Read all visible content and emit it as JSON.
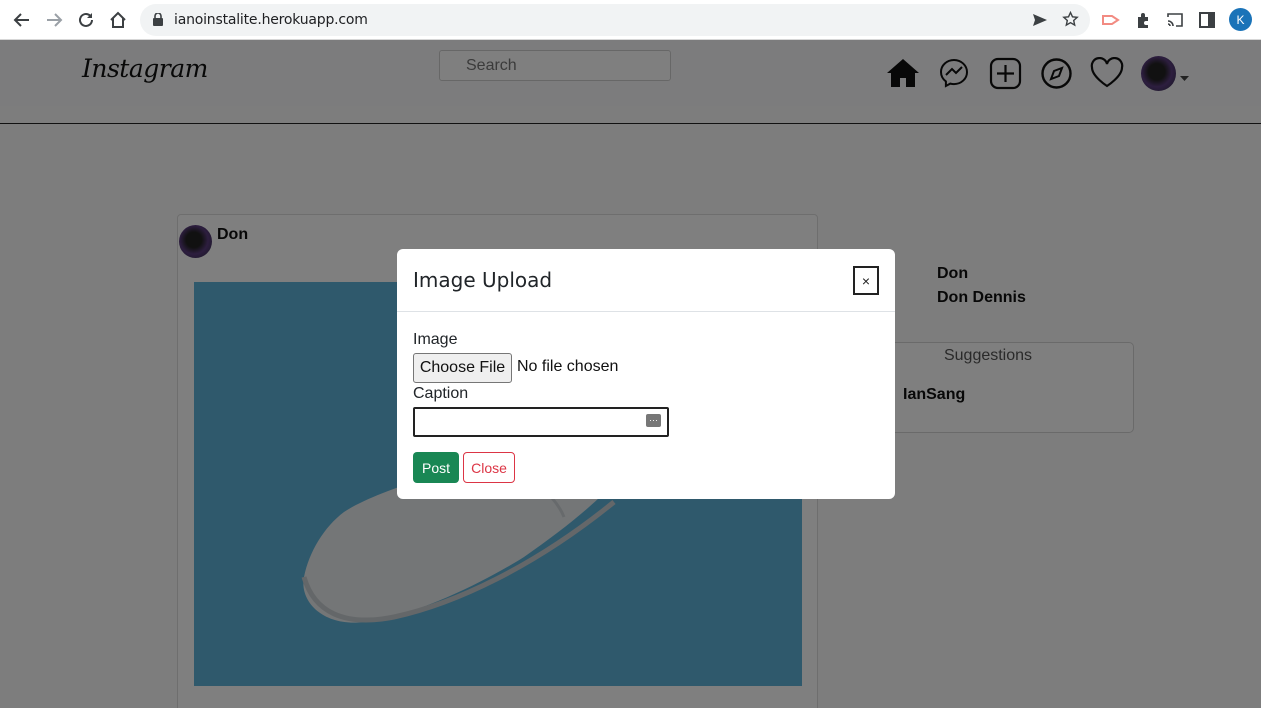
{
  "browser": {
    "url": "ianoinstalite.herokuapp.com",
    "profile_initial": "K"
  },
  "header": {
    "logo": "Instagram",
    "search_placeholder": "Search",
    "icons": [
      "home-icon",
      "messenger-icon",
      "add-post-icon",
      "explore-icon",
      "heart-icon",
      "profile-avatar"
    ]
  },
  "post": {
    "username": "Don"
  },
  "sidebar": {
    "username": "Don",
    "full_name": "Don Dennis",
    "suggestions_title": "Suggestions",
    "suggestions": [
      "IanSang"
    ]
  },
  "modal": {
    "title": "Image Upload",
    "close_symbol": "×",
    "image_label": "Image",
    "file_button": "Choose File",
    "file_status": "No file chosen",
    "caption_label": "Caption",
    "caption_value": "",
    "post_button": "Post",
    "close_button": "Close"
  },
  "colors": {
    "post_button": "#198754",
    "close_button": "#dc3545",
    "profile_badge": "#1a73b8"
  }
}
